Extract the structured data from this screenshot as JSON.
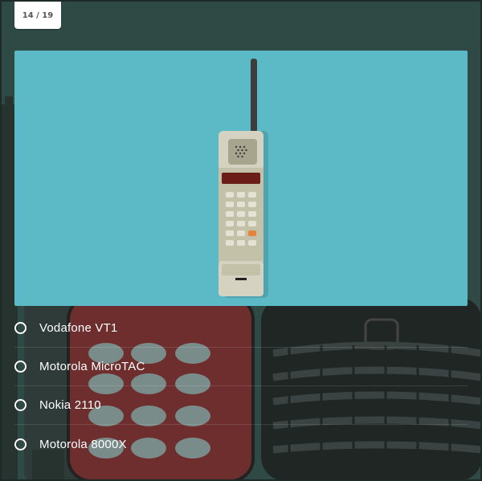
{
  "quiz": {
    "progress": "14 / 19",
    "current_question": 14,
    "total_questions": 19,
    "image_icon": "brick-cellphone-illustration",
    "options": [
      {
        "label": "Vodafone VT1"
      },
      {
        "label": "Motorola MicroTAC"
      },
      {
        "label": "Nokia 2110"
      },
      {
        "label": "Motorola 8000X"
      }
    ]
  },
  "colors": {
    "background": "#2f4a44",
    "image_bg": "#5cb9c6",
    "accent_key": "#e8823a"
  }
}
